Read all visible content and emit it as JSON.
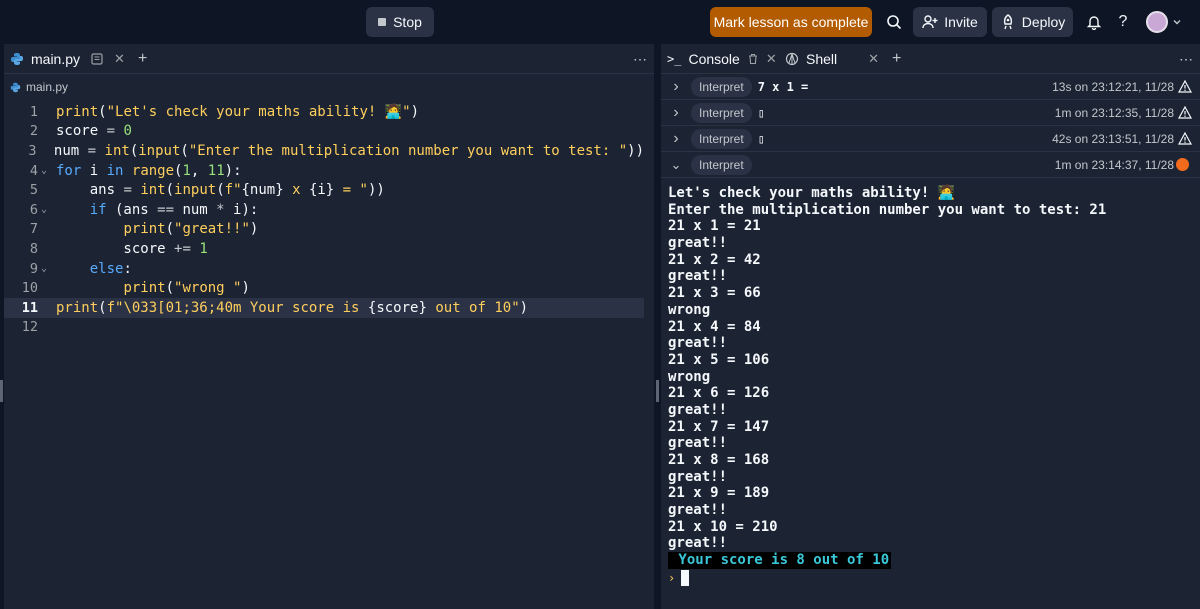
{
  "topbar": {
    "stop_label": "Stop",
    "mark_label": "Mark lesson as complete",
    "invite_label": "Invite",
    "deploy_label": "Deploy",
    "help_label": "?"
  },
  "editor": {
    "tab_label": "main.py",
    "breadcrumb": "main.py",
    "lines": [
      {
        "num": "1",
        "fold": "",
        "html": "<span class='f'>print</span><span class='t'>(</span><span class='s'>\"Let's check your maths ability! 🧑‍💻\"</span><span class='t'>)</span>"
      },
      {
        "num": "2",
        "fold": "",
        "html": "<span class='t'>score </span><span class='op'>=</span><span class='t'> </span><span class='n'>0</span>"
      },
      {
        "num": "3",
        "fold": "",
        "html": "<span class='t'>num </span><span class='op'>=</span><span class='t'> </span><span class='f'>int</span><span class='t'>(</span><span class='f'>input</span><span class='t'>(</span><span class='s'>\"Enter the multiplication number you want to test: \"</span><span class='t'>))</span>"
      },
      {
        "num": "4",
        "fold": "⌄",
        "html": "<span class='k'>for</span><span class='t'> i </span><span class='k'>in</span><span class='t'> </span><span class='f'>range</span><span class='t'>(</span><span class='n'>1</span><span class='t'>, </span><span class='n'>11</span><span class='t'>):</span>"
      },
      {
        "num": "5",
        "fold": "",
        "html": "<span class='t'>    ans </span><span class='op'>=</span><span class='t'> </span><span class='f'>int</span><span class='t'>(</span><span class='f'>input</span><span class='t'>(</span><span class='s'>f\"</span><span class='t'>{num}</span><span class='s'> x </span><span class='t'>{i}</span><span class='s'> = \"</span><span class='t'>))</span>"
      },
      {
        "num": "6",
        "fold": "⌄",
        "html": "<span class='t'>    </span><span class='k'>if</span><span class='t'> (ans </span><span class='op'>==</span><span class='t'> num </span><span class='op'>*</span><span class='t'> i):</span>"
      },
      {
        "num": "7",
        "fold": "",
        "html": "<span class='t'>        </span><span class='f'>print</span><span class='t'>(</span><span class='s'>\"great!!\"</span><span class='t'>)</span>"
      },
      {
        "num": "8",
        "fold": "",
        "html": "<span class='t'>        score </span><span class='op'>+=</span><span class='t'> </span><span class='n'>1</span>"
      },
      {
        "num": "9",
        "fold": "⌄",
        "html": "<span class='t'>    </span><span class='k'>else</span><span class='t'>:</span>"
      },
      {
        "num": "10",
        "fold": "",
        "html": "<span class='t'>        </span><span class='f'>print</span><span class='t'>(</span><span class='s'>\"wrong \"</span><span class='t'>)</span>"
      },
      {
        "num": "11",
        "fold": "",
        "active": true,
        "html": "<span class='f'>print</span><span class='t'>(</span><span class='s'>f\"\\033[01;36;40m Your score is </span><span class='t'>{score}</span><span class='s'> out of 10\"</span><span class='t'>)</span>"
      },
      {
        "num": "12",
        "fold": "",
        "html": ""
      }
    ]
  },
  "console": {
    "tab_console": "Console",
    "tab_shell": "Shell",
    "runs": [
      {
        "pill": "Interpret",
        "cmd": "7 x 1 =",
        "ts": "13s on 23:12:21, 11/28",
        "status": "warn",
        "expanded": false
      },
      {
        "pill": "Interpret",
        "cmd": "▯",
        "ts": "1m on 23:12:35, 11/28",
        "status": "warn",
        "expanded": false
      },
      {
        "pill": "Interpret",
        "cmd": "▯",
        "ts": "42s on 23:13:51, 11/28",
        "status": "warn",
        "expanded": false
      },
      {
        "pill": "Interpret",
        "cmd": "",
        "ts": "1m on 23:14:37, 11/28",
        "status": "running",
        "expanded": true
      }
    ],
    "output": [
      "Let's check your maths ability! 🧑‍💻",
      "Enter the multiplication number you want to test: 21",
      "21 x 1 = 21",
      "great!!",
      "21 x 2 = 42",
      "great!!",
      "21 x 3 = 66",
      "wrong",
      "21 x 4 = 84",
      "great!!",
      "21 x 5 = 106",
      "wrong",
      "21 x 6 = 126",
      "great!!",
      "21 x 7 = 147",
      "great!!",
      "21 x 8 = 168",
      "great!!",
      "21 x 9 = 189",
      "great!!",
      "21 x 10 = 210",
      "great!!"
    ],
    "score_line": " Your score is 8 out of 10",
    "prompt_mark": "›"
  }
}
